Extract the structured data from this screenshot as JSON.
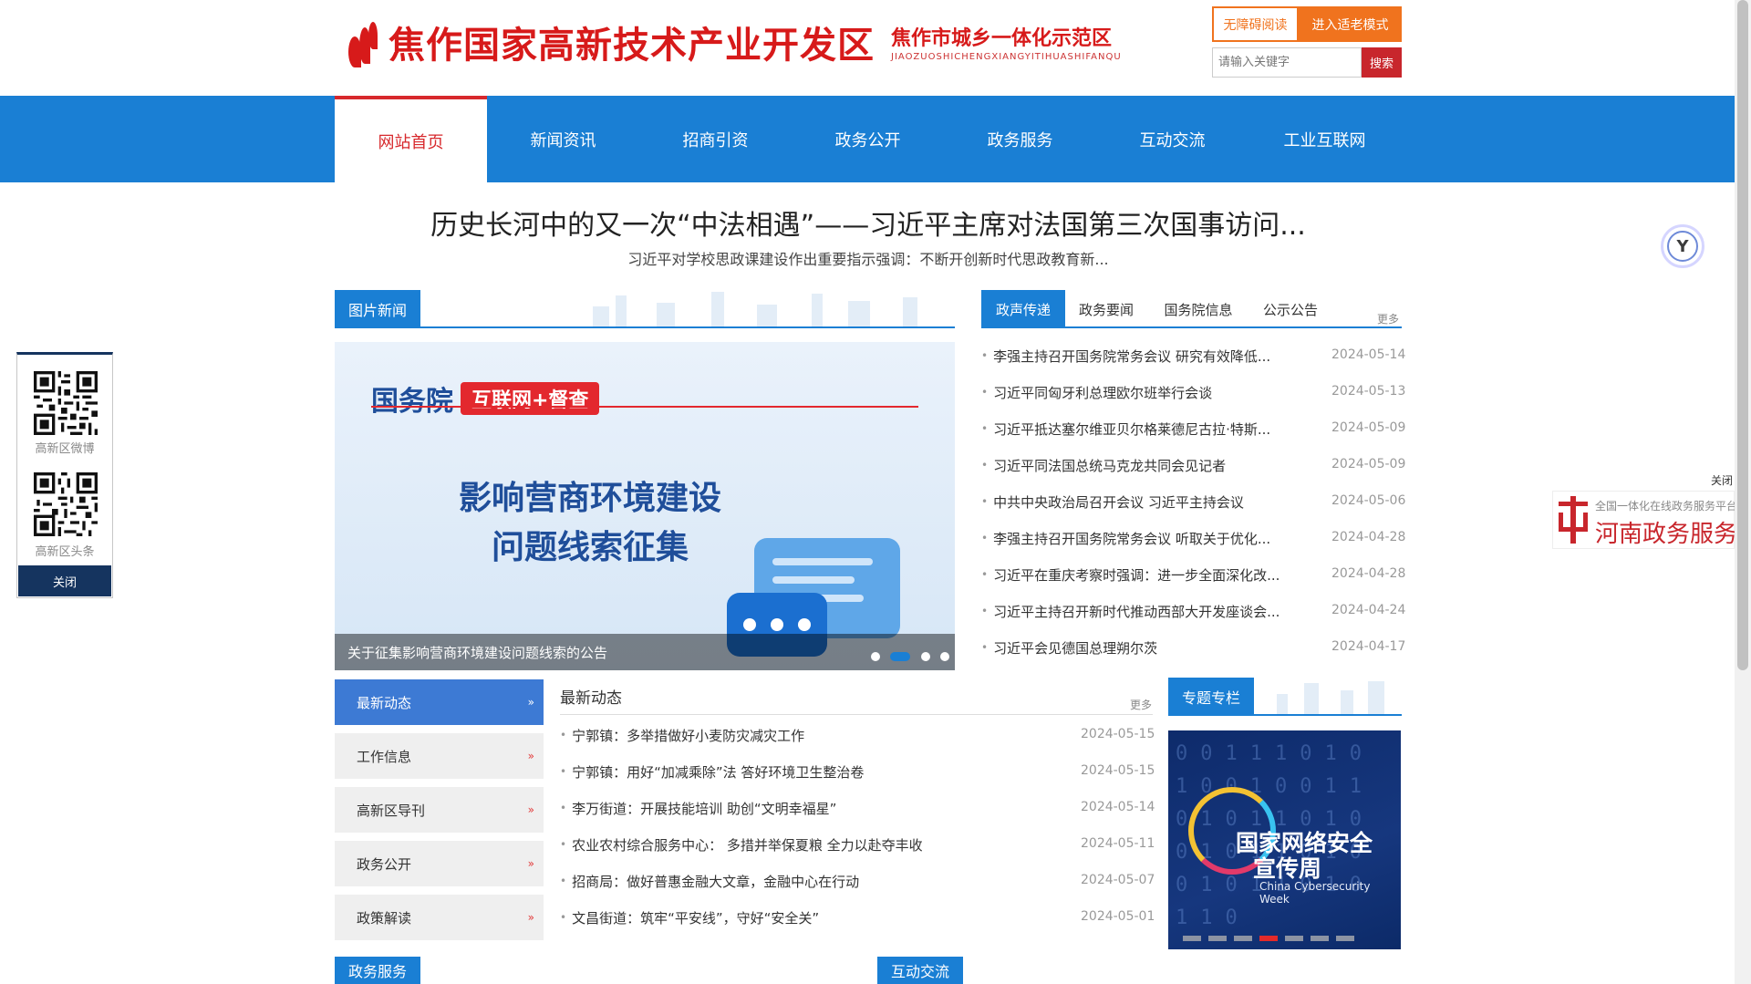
{
  "header": {
    "logo_title": "焦作国家高新技术产业开发区",
    "logo_subtitle": "焦作市城乡一体化示范区",
    "logo_subtitle_en": "JIAOZUOSHICHENGXIANGYITIHUASHIFANQU",
    "accessibility_label": "无障碍阅读",
    "elder_mode_label": "进入适老模式",
    "search_placeholder": "请输入关键字",
    "search_button": "搜索"
  },
  "nav": {
    "items": [
      "网站首页",
      "新闻资讯",
      "招商引资",
      "政务公开",
      "政务服务",
      "互动交流",
      "工业互联网"
    ],
    "active_index": 0
  },
  "headline": {
    "title": "历史长河中的又一次“中法相遇”——习近平主席对法国第三次国事访问...",
    "subtitle": "习近平对学校思政课建设作出重要指示强调：不断开创新时代思政教育新..."
  },
  "photo_news": {
    "section_title": "图片新闻",
    "brand_a": "国务院",
    "brand_b": "互联网+督查",
    "big_text_line1": "影响营商环境建设",
    "big_text_line2": "问题线索征集",
    "caption": "关于征集影响营商环境建设问题线索的公告",
    "active_slide": 1,
    "slide_count": 4
  },
  "right_news": {
    "tabs": [
      "政声传递",
      "政务要闻",
      "国务院信息",
      "公示公告"
    ],
    "active_tab": 0,
    "more": "更多",
    "items": [
      {
        "title": "李强主持召开国务院常务会议 研究有效降低...",
        "date": "2024-05-14"
      },
      {
        "title": "习近平同匈牙利总理欧尔班举行会谈",
        "date": "2024-05-13"
      },
      {
        "title": "习近平抵达塞尔维亚贝尔格莱德尼古拉·特斯...",
        "date": "2024-05-09"
      },
      {
        "title": "习近平同法国总统马克龙共同会见记者",
        "date": "2024-05-09"
      },
      {
        "title": "中共中央政治局召开会议 习近平主持会议",
        "date": "2024-05-06"
      },
      {
        "title": "李强主持召开国务院常务会议 听取关于优化...",
        "date": "2024-04-28"
      },
      {
        "title": "习近平在重庆考察时强调：进一步全面深化改...",
        "date": "2024-04-28"
      },
      {
        "title": "习近平主持召开新时代推动西部大开发座谈会...",
        "date": "2024-04-24"
      },
      {
        "title": "习近平会见德国总理朔尔茨",
        "date": "2024-04-17"
      }
    ]
  },
  "left_menu": {
    "items": [
      "最新动态",
      "工作信息",
      "高新区导刊",
      "政务公开",
      "政策解读"
    ],
    "active_index": 0,
    "arrow": "»"
  },
  "latest": {
    "heading": "最新动态",
    "more": "更多",
    "items": [
      {
        "title": "宁郭镇：多举措做好小麦防灾减灾工作",
        "date": "2024-05-15"
      },
      {
        "title": "宁郭镇：用好“加减乘除”法 答好环境卫生整治卷",
        "date": "2024-05-15"
      },
      {
        "title": "李万街道：开展技能培训 助创“文明幸福星”",
        "date": "2024-05-14"
      },
      {
        "title": "农业农村综合服务中心： 多措并举保夏粮 全力以赴夺丰收",
        "date": "2024-05-11"
      },
      {
        "title": "招商局：做好普惠金融大文章，金融中心在行动",
        "date": "2024-05-07"
      },
      {
        "title": "文昌街道：筑牢“平安线”，守好“安全关”",
        "date": "2024-05-01"
      }
    ]
  },
  "special": {
    "section_title": "专题专栏",
    "title_line1": "国家网络安全",
    "title_line2": "宣传周",
    "title_en": "China Cybersecurity Week",
    "bits": "0011101010010011010110100101101001011010110",
    "active_slide": 3,
    "slide_count": 7
  },
  "bottom_sections": {
    "left_title": "政务服务",
    "right_title": "互动交流"
  },
  "qr_panel": {
    "weibo_label": "高新区微博",
    "toutiao_label": "高新区头条",
    "close_label": "关闭"
  },
  "henan_badge": {
    "close_label": "关闭",
    "small_text": "全国一体化在线政务服务平台",
    "big_text": "河南政务服务网"
  },
  "assistant": {
    "icon": "accessibility-assistant-icon",
    "glyph": "Y"
  },
  "colors": {
    "brand_red": "#d71a1a",
    "nav_blue": "#1a7fd4",
    "accent_orange": "#f0731e",
    "qr_navy": "#15345f"
  }
}
